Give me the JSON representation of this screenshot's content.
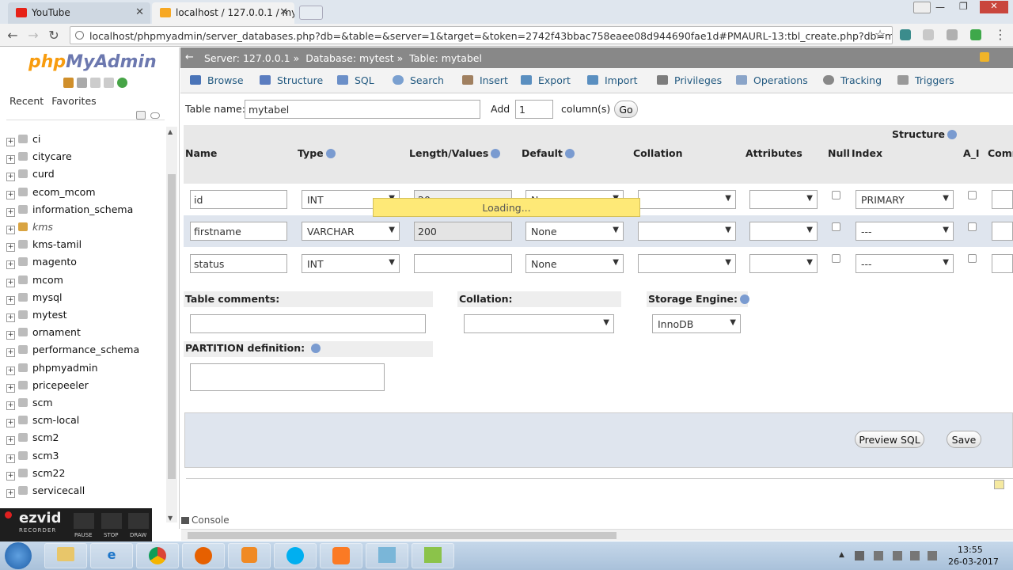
{
  "browser": {
    "tabs": [
      {
        "label": "YouTube",
        "favicon_color": "#e62117"
      },
      {
        "label": "localhost / 127.0.0.1 / my",
        "favicon_color": "#f7a823"
      }
    ],
    "url": "localhost/phpmyadmin/server_databases.php?db=&table=&server=1&target=&token=2742f43bbac758eaee08d944690fae1d#PMAURL-13:tbl_create.php?db=mytest&tal",
    "back_icon": "←",
    "forward_icon": "→",
    "reload_icon": "↻",
    "star_icon": "☆",
    "menu_icon": "⋮"
  },
  "sidebar": {
    "logo_php": "php",
    "logo_myadmin": "MyAdmin",
    "links": [
      "Recent",
      "Favorites"
    ],
    "databases": [
      "ci",
      "citycare",
      "curd",
      "ecom_mcom",
      "information_schema",
      "kms",
      "kms-tamil",
      "magento",
      "mcom",
      "mysql",
      "mytest",
      "ornament",
      "performance_schema",
      "phpmyadmin",
      "pricepeeler",
      "scm",
      "scm-local",
      "scm2",
      "scm3",
      "scm22",
      "servicecall"
    ]
  },
  "breadcrumb": {
    "server": "Server: 127.0.0.1 »",
    "database": "Database: mytest »",
    "table": "Table: mytabel"
  },
  "toptabs": [
    "Browse",
    "Structure",
    "SQL",
    "Search",
    "Insert",
    "Export",
    "Import",
    "Privileges",
    "Operations",
    "Tracking",
    "Triggers"
  ],
  "form": {
    "table_name_label": "Table name:",
    "table_name_value": "mytabel",
    "add_label": "Add",
    "add_value": "1",
    "columns_label": "column(s)",
    "go": "Go",
    "structure_label": "Structure",
    "headers": {
      "name": "Name",
      "type": "Type",
      "length": "Length/Values",
      "default": "Default",
      "collation": "Collation",
      "attributes": "Attributes",
      "null": "Null",
      "index": "Index",
      "ai": "A_I",
      "comments": "Comm"
    },
    "rows": [
      {
        "name": "id",
        "type": "INT",
        "length": "20",
        "default": "None",
        "index": "PRIMARY"
      },
      {
        "name": "firstname",
        "type": "VARCHAR",
        "length": "200",
        "default": "None",
        "index": "---"
      },
      {
        "name": "status",
        "type": "INT",
        "length": "",
        "default": "None",
        "index": "---"
      }
    ],
    "table_comments": "Table comments:",
    "collation": "Collation:",
    "storage_engine": "Storage Engine:",
    "storage_engine_value": "InnoDB",
    "partition": "PARTITION definition:",
    "preview_sql": "Preview SQL",
    "save": "Save",
    "loading": "Loading...",
    "console": "Console"
  },
  "recorder": {
    "brand": "ezvid",
    "sub": "RECORDER",
    "pause": "PAUSE",
    "stop": "STOP",
    "draw": "DRAW"
  },
  "taskbar": {
    "time": "13:55",
    "date": "26-03-2017"
  }
}
